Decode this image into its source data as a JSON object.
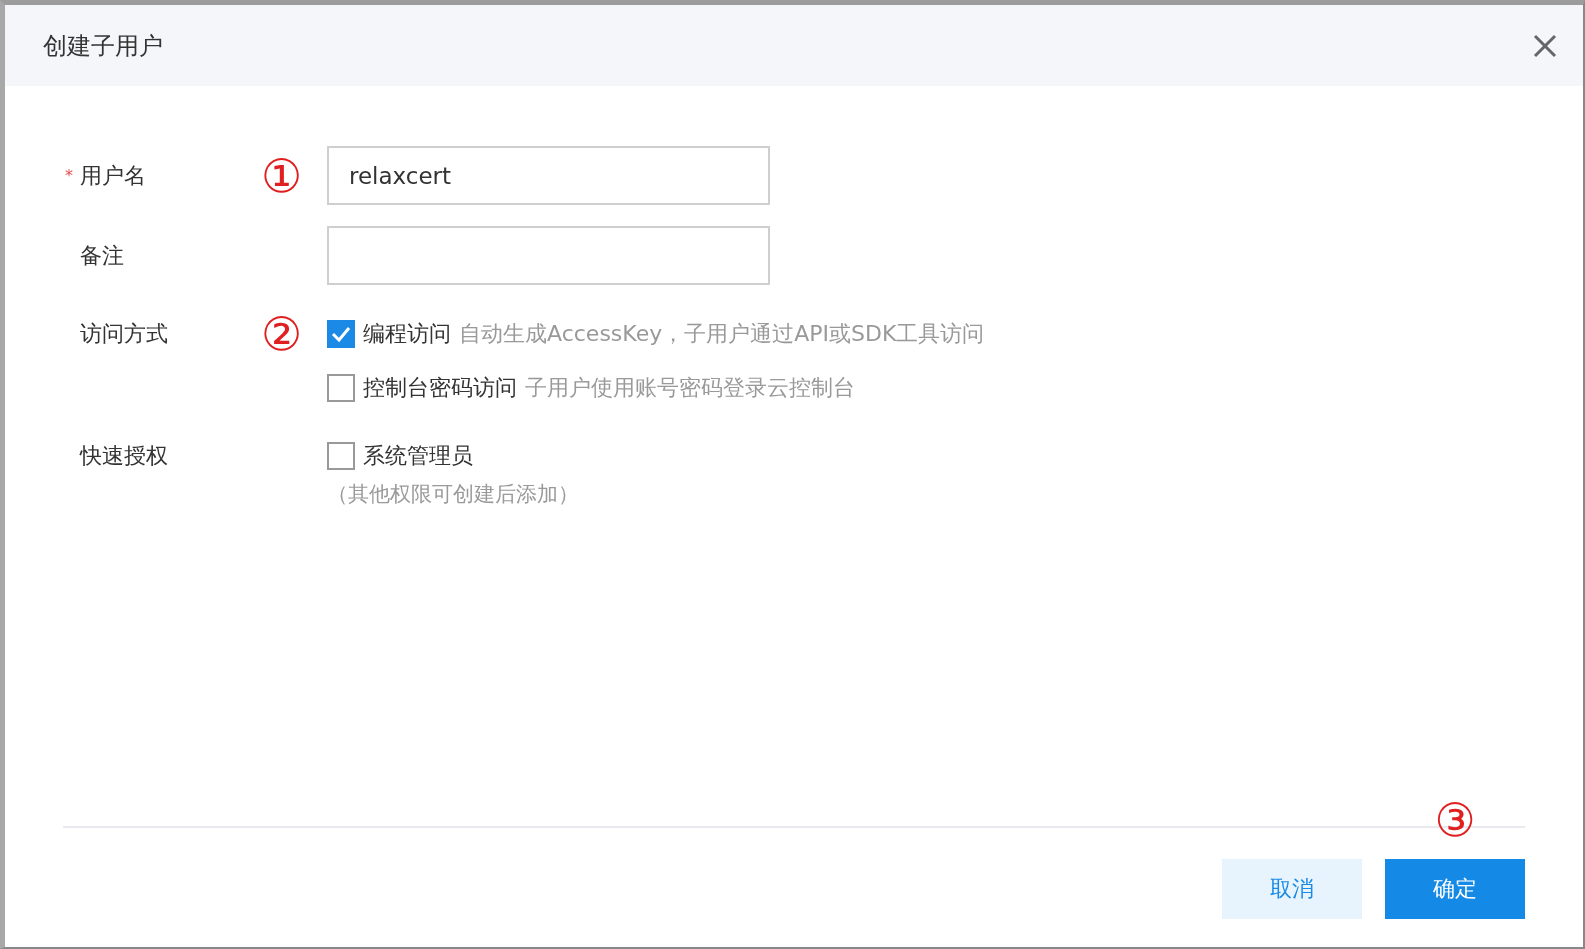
{
  "dialog": {
    "title": "创建子用户"
  },
  "form": [
    {
      "kind": "input",
      "required_mark": "*",
      "label": "用户名",
      "value": "relaxcert",
      "annotation": "①"
    },
    {
      "kind": "input",
      "label": "备注"
    },
    {
      "kind": "checks",
      "label": "访问方式",
      "annotation": "②",
      "options": [
        {
          "label": "编程访问",
          "hint": "自动生成AccessKey，子用户通过API或SDK工具访问",
          "checked": true
        },
        {
          "label": "控制台密码访问",
          "hint": "子用户使用账号密码登录云控制台",
          "checked": false
        }
      ]
    },
    {
      "kind": "checks",
      "label": "快速授权",
      "options": [
        {
          "label": "系统管理员",
          "checked": false
        }
      ],
      "note": "（其他权限可创建后添加）"
    }
  ],
  "buttons": [
    {
      "label": "取消",
      "kind": "secondary"
    },
    {
      "label": "确定",
      "kind": "primary",
      "annotation": "③"
    }
  ]
}
